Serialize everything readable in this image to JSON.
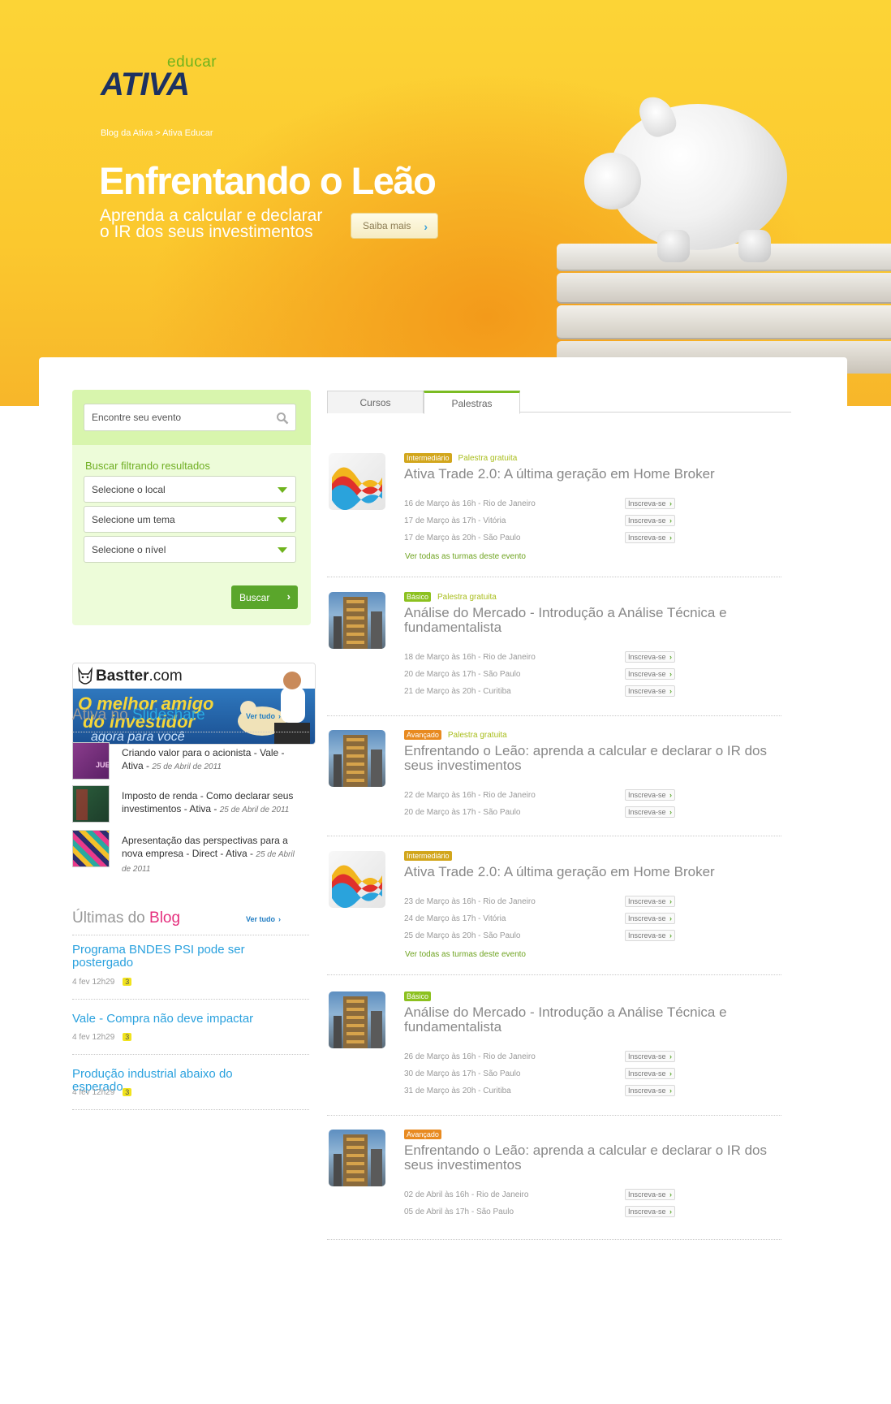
{
  "brand": {
    "sub": "educar",
    "main": "ATIVA"
  },
  "breadcrumb": "Blog da Ativa > Ativa Educar",
  "hero": {
    "title": "Enfrentando o Leão",
    "subtitle_line1": "Aprenda a calcular e declarar",
    "subtitle_line2": "o IR dos seus investimentos",
    "button": "Saiba mais"
  },
  "search": {
    "placeholder": "Encontre seu evento",
    "filter_title": "Buscar filtrando resultados",
    "selects": [
      "Selecione o local",
      "Selecione um tema",
      "Selecione o nível"
    ],
    "button": "Buscar"
  },
  "banner": {
    "name": "Bastter",
    "domain": ".com",
    "line1": "O melhor amigo",
    "line2": "do investidor",
    "line3": "agora para você"
  },
  "slideshare": {
    "heading_a": "Ativa no ",
    "heading_b": "Slideshare",
    "ver_tudo": "Ver tudo",
    "items": [
      {
        "text": "Criando valor para o acionista - Vale - Ativa - ",
        "date": "25 de Abril de 2011"
      },
      {
        "text": "Imposto de renda - Como declarar seus investimentos - Ativa - ",
        "date": "25 de Abril de 2011"
      },
      {
        "text": "Apresentação das perspectivas para a nova empresa - Direct - Ativa - ",
        "date": "25 de Abril de 2011"
      }
    ]
  },
  "blog": {
    "heading_a": "Últimas do ",
    "heading_b": "Blog",
    "ver_tudo": "Ver tudo",
    "posts": [
      {
        "title": "Programa BNDES PSI pode ser postergado",
        "meta": "4 fev 12h29",
        "comments": "3"
      },
      {
        "title": "Vale - Compra não deve impactar",
        "meta": "4 fev 12h29",
        "comments": "3"
      },
      {
        "title": "Produção industrial abaixo do esperado",
        "meta": "4 fev 12h29",
        "comments": "3"
      }
    ]
  },
  "tabs": [
    "Cursos",
    "Palestras"
  ],
  "inscreva": "Inscreva-se",
  "ver_turmas": "Ver todas as turmas deste evento",
  "events": [
    {
      "level": "Intermediário",
      "free": "Palestra gratuita",
      "title": "Ativa Trade 2.0: A última geração em Home Broker",
      "dates": [
        "16 de Março às 16h - Rio de Janeiro",
        "17 de Março às 17h - Vitória",
        "17 de Março às 20h - São Paulo"
      ]
    },
    {
      "level": "Básico",
      "free": "Palestra gratuita",
      "title": "Análise do Mercado - Introdução a Análise Técnica e fundamentalista",
      "dates": [
        "18 de Março às 16h - Rio de Janeiro",
        "20 de Março às 17h - São Paulo",
        "21 de Março às 20h - Curitiba"
      ]
    },
    {
      "level": "Avançado",
      "free": "Palestra gratuita",
      "title": "Enfrentando o Leão: aprenda a calcular e declarar o IR dos seus investimentos",
      "dates": [
        "22 de Março às 16h - Rio de Janeiro",
        "20 de Março às 17h - São Paulo"
      ]
    },
    {
      "level": "Intermediário",
      "free": "",
      "title": "Ativa Trade 2.0: A última geração em Home Broker",
      "dates": [
        "23 de Março às 16h - Rio de Janeiro",
        "24 de Março às 17h - Vitória",
        "25 de Março às 20h - São Paulo"
      ]
    },
    {
      "level": "Básico",
      "free": "",
      "title": "Análise do Mercado - Introdução a Análise Técnica e fundamentalista",
      "dates": [
        "26 de Março às 16h - Rio de Janeiro",
        "30 de Março às 17h - São Paulo",
        "31 de Março às 20h - Curitiba"
      ]
    },
    {
      "level": "Avançado",
      "free": "",
      "title": "Enfrentando o Leão: aprenda a calcular e declarar o IR dos seus investimentos",
      "dates": [
        "02 de Abril às 16h - Rio de Janeiro",
        "05 de Abril às 17h - São Paulo"
      ]
    }
  ]
}
